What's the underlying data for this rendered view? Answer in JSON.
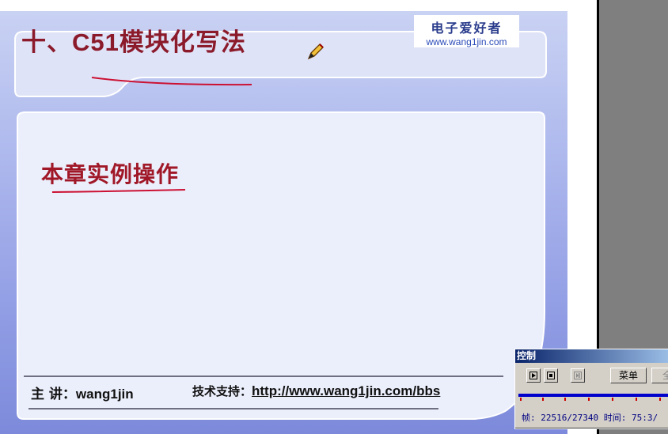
{
  "slide": {
    "title": {
      "prefix": "十、",
      "latin": "C51",
      "suffix": "模块化写法"
    },
    "logo": {
      "cn": "电子爱好者",
      "url": "www.wang1jin.com"
    },
    "section_title": "本章实例操作",
    "footer": {
      "lecturer_label": "主 讲：",
      "lecturer_name": "wang1jin",
      "support_label": "技术支持：",
      "support_url": "http://www.wang1jin.com/bbs"
    },
    "colors": {
      "title": "#8b1a2b",
      "ink": "#cc1133"
    }
  },
  "control_window": {
    "title": "控制",
    "buttons": {
      "play_icon": "play-icon",
      "stop_icon": "stop-icon",
      "step_icon": "step-icon"
    },
    "menu_label": "菜单",
    "extra_label": "全",
    "status": "帧: 22516/27340 时间: 75:3/"
  }
}
